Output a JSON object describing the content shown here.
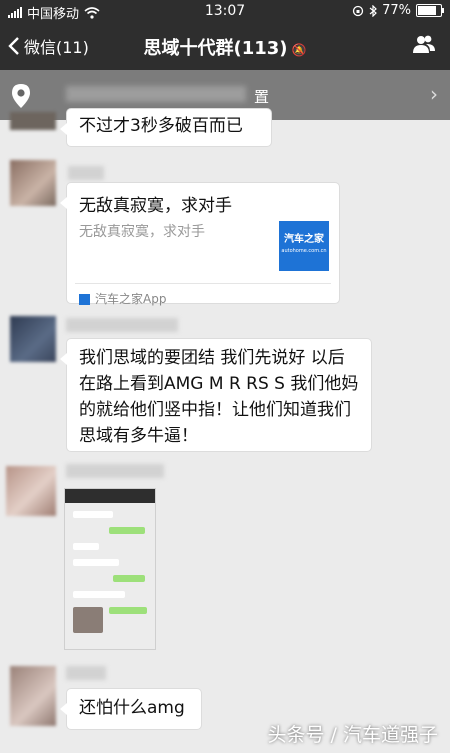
{
  "status": {
    "carrier": "中国移动",
    "time": "13:07",
    "battery": "77%"
  },
  "nav": {
    "back_label": "微信(11)",
    "title": "思域十代群(113)"
  },
  "location_bar": {
    "text": "置"
  },
  "messages": [
    {
      "text": "不过才3秒多破百而已"
    },
    {
      "card_title": "无敌真寂寞，求对手",
      "card_desc": "无敌真寂寞，求对手",
      "logo_text": "汽车之家",
      "logo_sub": "autohome.com.cn",
      "source": "汽车之家App"
    },
    {
      "text": "我们思域的要团结 我们先说好 以后在路上看到AMG M R RS S 我们他妈的就给他们竖中指！让他们知道我们思域有多牛逼！"
    },
    {
      "type": "image"
    },
    {
      "text": "还怕什么amg"
    }
  ],
  "watermark": "头条号 / 汽车道强子",
  "colors": {
    "navbar": "#2e2e2e",
    "chat_bg": "#ebebeb",
    "bubble": "#ffffff",
    "logo_blue": "#1e73d6"
  }
}
